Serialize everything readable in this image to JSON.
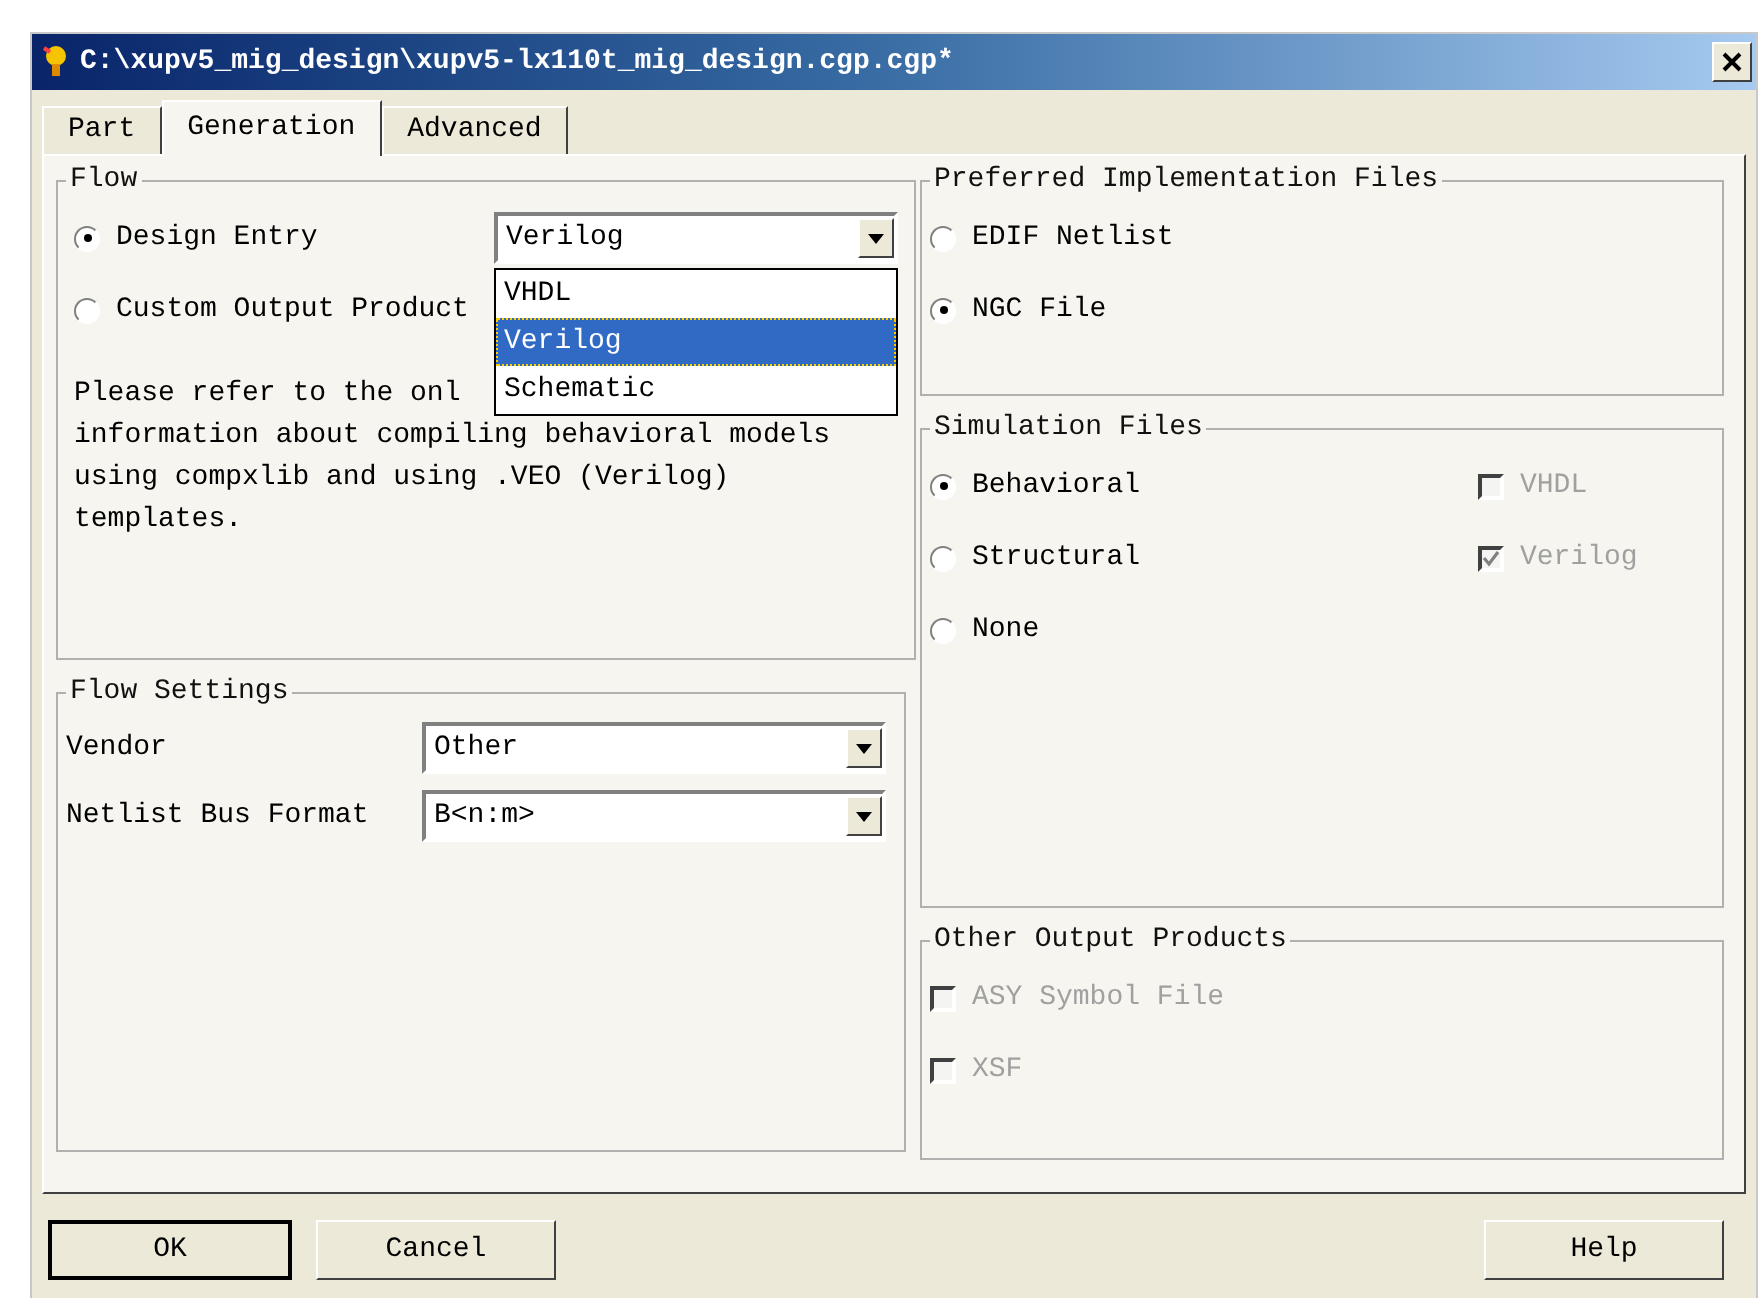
{
  "window": {
    "title": "C:\\xupv5_mig_design\\xupv5-lx110t_mig_design.cgp.cgp*"
  },
  "tabs": [
    {
      "label": "Part",
      "selected": false
    },
    {
      "label": "Generation",
      "selected": true
    },
    {
      "label": "Advanced",
      "selected": false
    }
  ],
  "flow": {
    "title": "Flow",
    "options": [
      {
        "label": "Design Entry",
        "selected": true
      },
      {
        "label": "Custom Output Product",
        "selected": false
      }
    ],
    "design_entry_select": {
      "value": "Verilog",
      "expanded": true,
      "options": [
        {
          "label": "VHDL",
          "selected": false
        },
        {
          "label": "Verilog",
          "selected": true
        },
        {
          "label": "Schematic",
          "selected": false
        }
      ]
    },
    "note_lines": [
      "Please refer to the onl",
      "information about compiling behavioral models",
      "using compxlib and using .VEO (Verilog)",
      "templates."
    ]
  },
  "flow_settings": {
    "title": "Flow Settings",
    "fields": [
      {
        "label": "Vendor",
        "value": "Other"
      },
      {
        "label": "Netlist Bus Format",
        "value": "B<n:m>"
      }
    ]
  },
  "preferred_implementation_files": {
    "title": "Preferred Implementation Files",
    "options": [
      {
        "label": "EDIF Netlist",
        "selected": false
      },
      {
        "label": "NGC File",
        "selected": true
      }
    ]
  },
  "simulation_files": {
    "title": "Simulation Files",
    "options": [
      {
        "label": "Behavioral",
        "selected": true
      },
      {
        "label": "Structural",
        "selected": false
      },
      {
        "label": "None",
        "selected": false
      }
    ],
    "languages": [
      {
        "label": "VHDL",
        "checked": false,
        "disabled": true
      },
      {
        "label": "Verilog",
        "checked": true,
        "disabled": true
      }
    ]
  },
  "other_output_products": {
    "title": "Other Output Products",
    "items": [
      {
        "label": "ASY Symbol File",
        "checked": false,
        "disabled": true
      },
      {
        "label": "XSF",
        "checked": false,
        "disabled": true
      }
    ]
  },
  "buttons": [
    {
      "label": "OK",
      "kind": "default"
    },
    {
      "label": "Cancel",
      "kind": "normal"
    },
    {
      "label": "Help",
      "kind": "normal"
    }
  ]
}
